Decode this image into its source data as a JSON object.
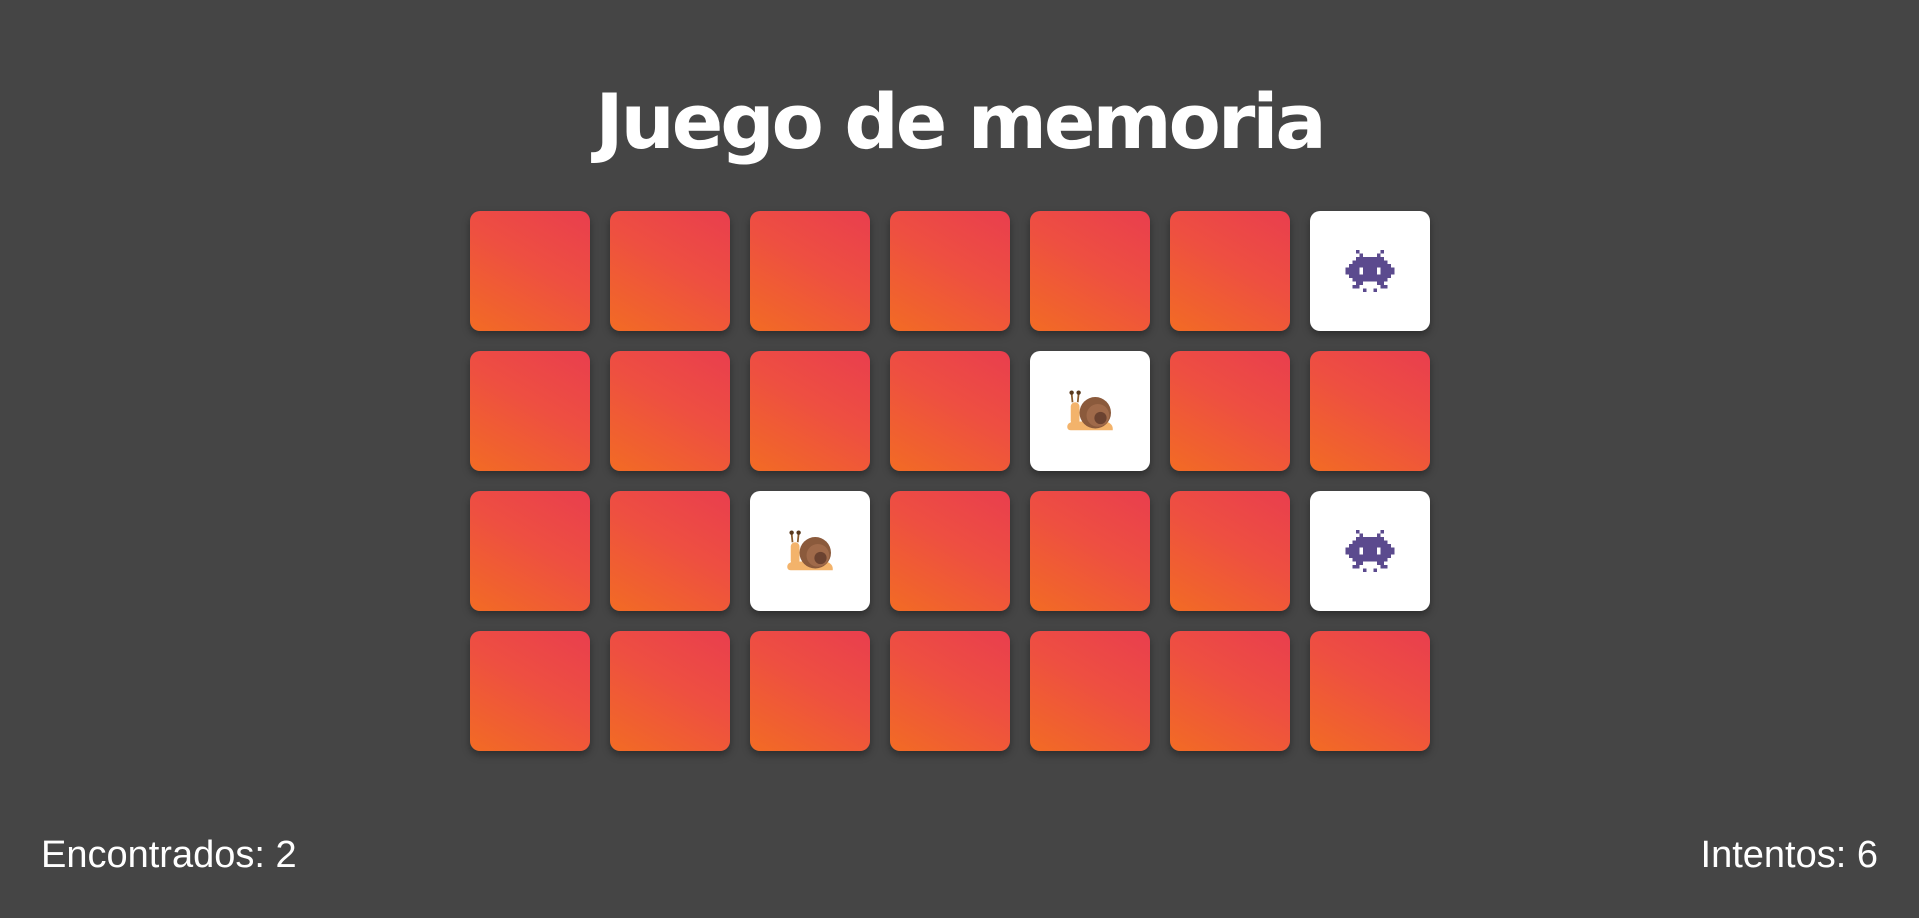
{
  "title": "Juego de memoria",
  "stats": {
    "found_label": "Encontrados: 2",
    "attempts_label": "Intentos: 6"
  },
  "colors": {
    "background": "#454545",
    "card_back_top": "#e93e4e",
    "card_back_bottom": "#f26b24",
    "card_face": "#ffffff"
  },
  "board": {
    "columns": 7,
    "rows": 4,
    "cards": [
      {
        "state": "hidden"
      },
      {
        "state": "hidden"
      },
      {
        "state": "hidden"
      },
      {
        "state": "hidden"
      },
      {
        "state": "hidden"
      },
      {
        "state": "hidden"
      },
      {
        "state": "revealed",
        "icon": "alien-monster-icon"
      },
      {
        "state": "hidden"
      },
      {
        "state": "hidden"
      },
      {
        "state": "hidden"
      },
      {
        "state": "hidden"
      },
      {
        "state": "revealed",
        "icon": "snail-icon"
      },
      {
        "state": "hidden"
      },
      {
        "state": "hidden"
      },
      {
        "state": "hidden"
      },
      {
        "state": "hidden"
      },
      {
        "state": "revealed",
        "icon": "snail-icon"
      },
      {
        "state": "hidden"
      },
      {
        "state": "hidden"
      },
      {
        "state": "hidden"
      },
      {
        "state": "revealed",
        "icon": "alien-monster-icon"
      },
      {
        "state": "hidden"
      },
      {
        "state": "hidden"
      },
      {
        "state": "hidden"
      },
      {
        "state": "hidden"
      },
      {
        "state": "hidden"
      },
      {
        "state": "hidden"
      },
      {
        "state": "hidden"
      }
    ]
  }
}
